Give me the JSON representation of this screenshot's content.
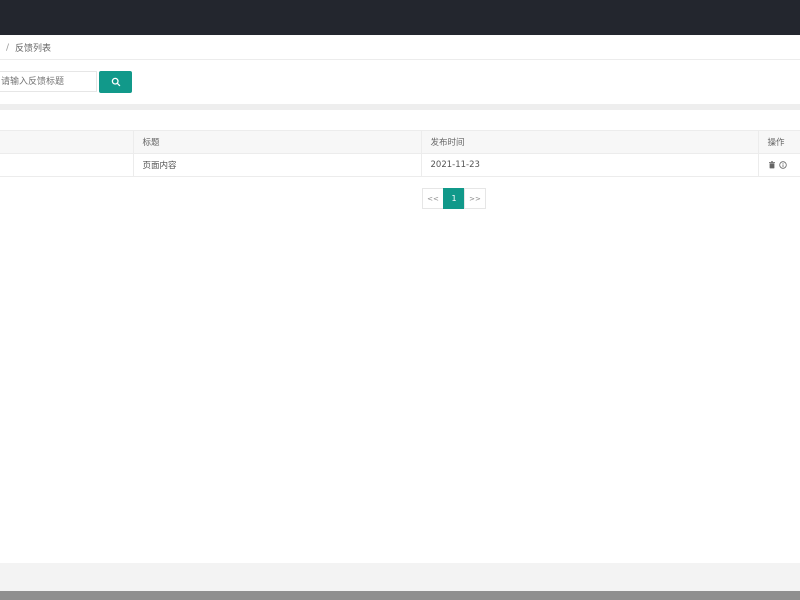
{
  "breadcrumb": {
    "separator": "/",
    "current": "反馈列表"
  },
  "search": {
    "placeholder": "请输入反馈标题",
    "value": "",
    "button_icon": "search-icon"
  },
  "table": {
    "columns": [
      "",
      "标题",
      "发布时间",
      "操作"
    ],
    "rows": [
      {
        "col0": "",
        "title": "页面内容",
        "publish_time": "2021-11-23",
        "actions": [
          "delete-icon",
          "info-icon"
        ]
      }
    ]
  },
  "pagination": {
    "prev": "<<",
    "current": "1",
    "next": ">>"
  },
  "colors": {
    "topbar": "#23262e",
    "accent": "#11998a"
  }
}
